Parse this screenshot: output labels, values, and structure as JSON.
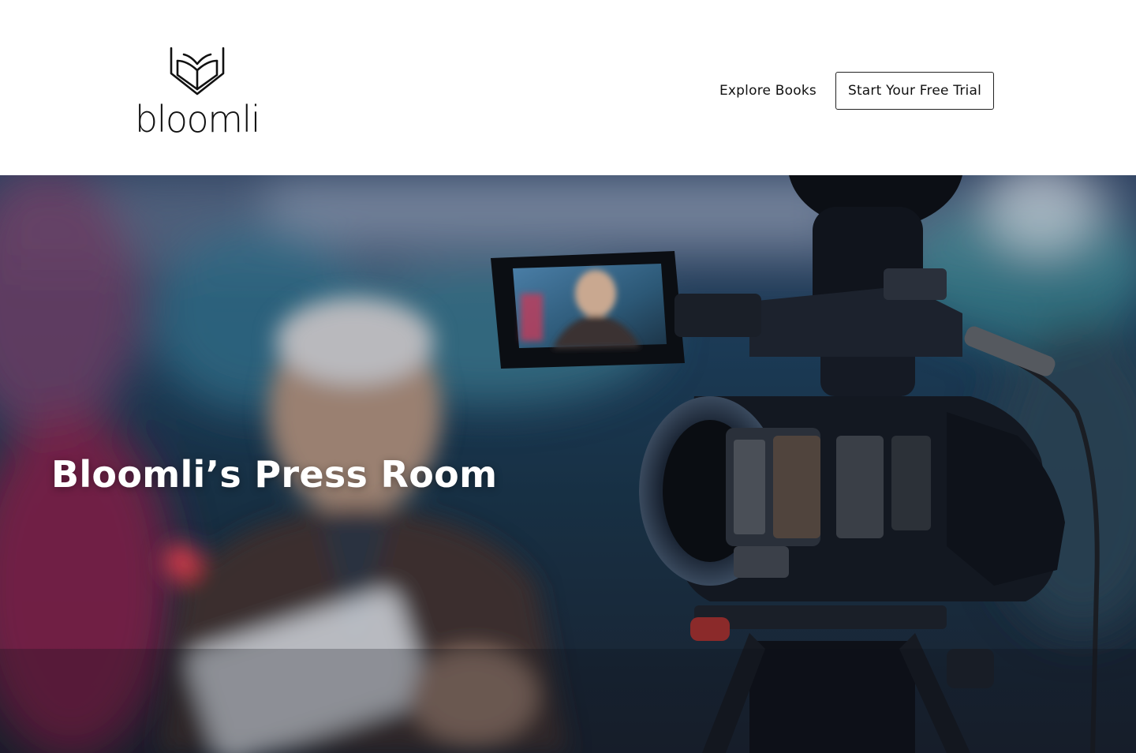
{
  "brand": {
    "name": "bloomli",
    "icon": "open-book-icon"
  },
  "nav": {
    "explore_label": "Explore Books",
    "cta_label": "Start Your Free Trial"
  },
  "hero": {
    "title": "Bloomli’s Press Room",
    "image": "video-camera-recording-speaker-photo"
  },
  "colors": {
    "header_bg": "#ffffff",
    "text_dark": "#111111",
    "hero_title": "#ffffff"
  }
}
